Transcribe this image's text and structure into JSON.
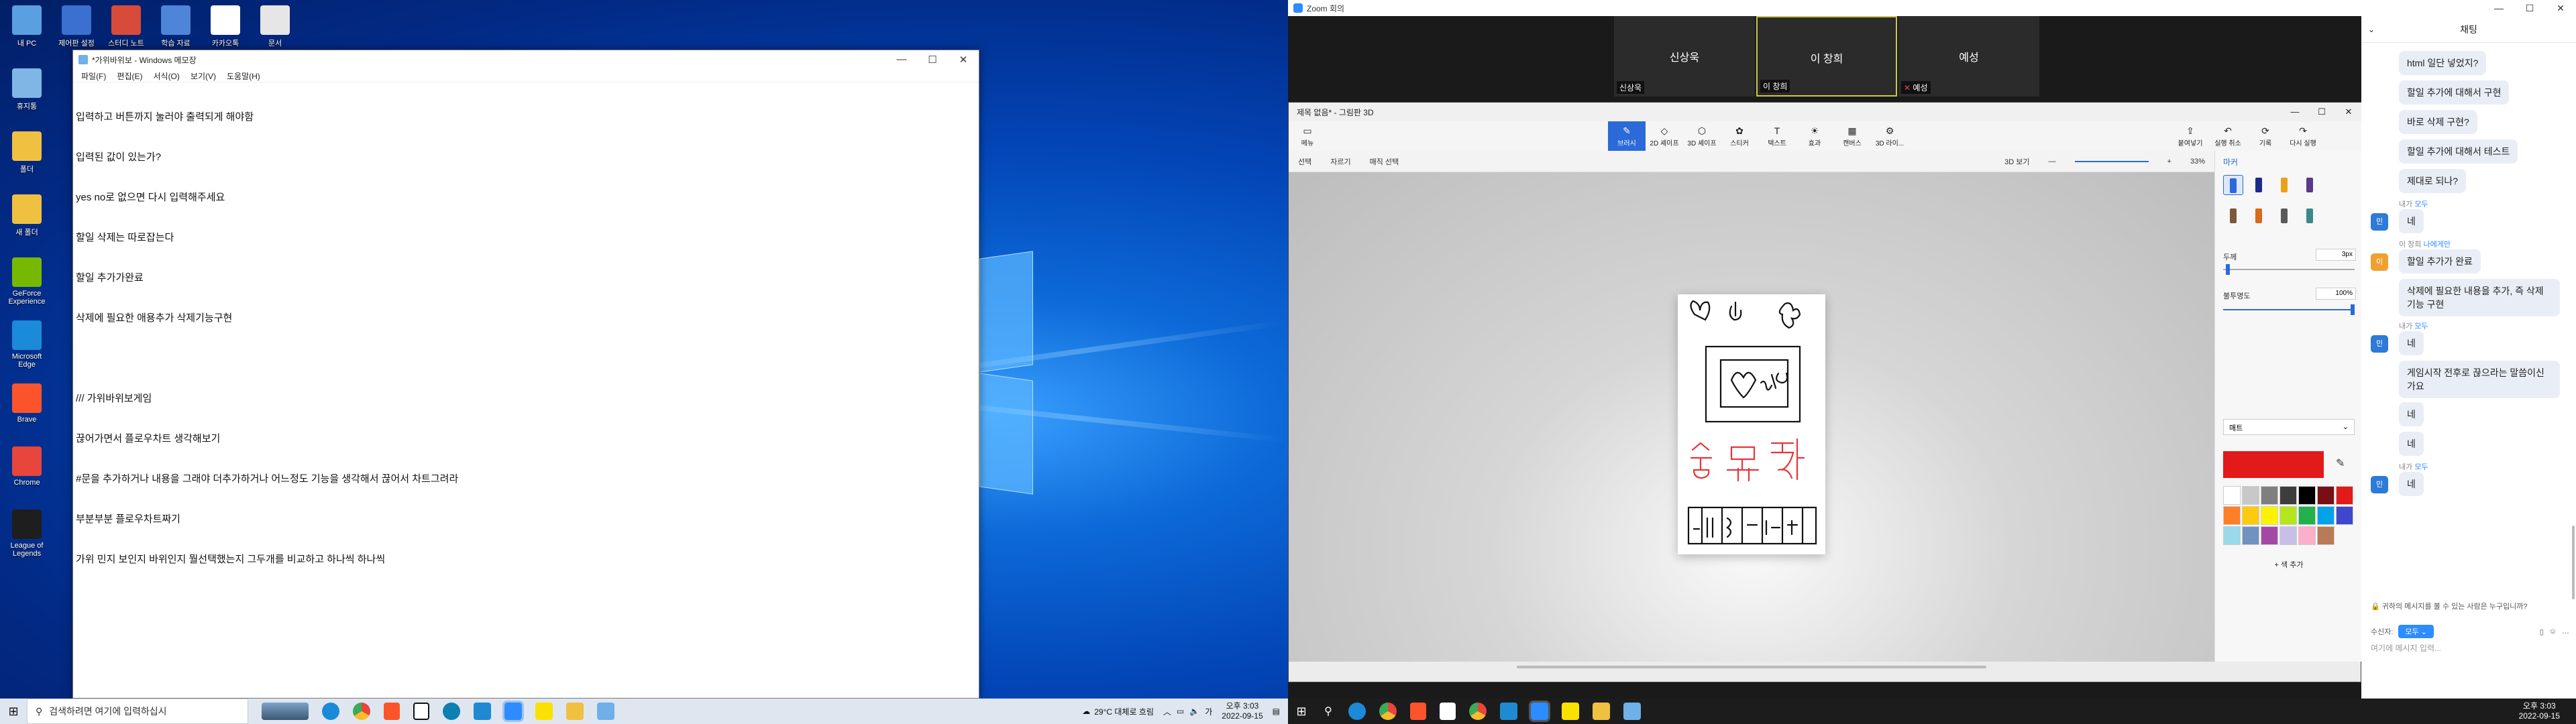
{
  "left_desktop": {
    "icons_col1": [
      {
        "label": "내 PC",
        "color": "#5aa0e0"
      },
      {
        "label": "휴지통",
        "color": "#7eb7e6"
      },
      {
        "label": "폴더",
        "color": "#f0c040"
      },
      {
        "label": "새 폴더",
        "color": "#f0c040"
      },
      {
        "label": "GeForce Experience",
        "color": "#76b900"
      },
      {
        "label": "Microsoft Edge",
        "color": "#1b8ad8"
      },
      {
        "label": "Brave",
        "color": "#fb542b"
      },
      {
        "label": "Chrome",
        "color": "#e8453c"
      },
      {
        "label": "League of Legends",
        "color": "#1e1e1e"
      }
    ],
    "icons_row_top": [
      {
        "label": "제어판 설정",
        "color": "#3b6fd0"
      },
      {
        "label": "스터디 노트",
        "color": "#d84a3a"
      },
      {
        "label": "학습 자료",
        "color": "#4f85d8"
      },
      {
        "label": "카카오톡",
        "color": "#ffffff"
      },
      {
        "label": "문서",
        "color": "#e6e6e6"
      }
    ]
  },
  "notepad": {
    "title": "*가위바위보 - Windows 메모장",
    "menu": [
      "파일(F)",
      "편집(E)",
      "서식(O)",
      "보기(V)",
      "도움말(H)"
    ],
    "lines": [
      "입력하고 버튼까지 눌러야 출력되게 해야함",
      "입력된 값이 있는가?",
      "yes no로 없으면 다시 입력해주세요",
      "할일 삭제는 따로잡는다",
      "할일 추가가완료",
      "삭제에 필요한 애용추가 삭제기능구현",
      "",
      "/// 가위바위보게임",
      "끊어가면서 플로우차트 생각해보기",
      "#문을 추가하거나 내용을 그래야 더추가하거나 어느정도 기능을 생각해서 끊어서 차트그려라",
      "부분부분 플로우차트짜기",
      "가위 민지 보인지 바위인지 뭘선택했는지 그두개를 비교하고 하나씩 하나씩"
    ]
  },
  "taskbar_left": {
    "search_placeholder": "검색하려면 여기에 입력하십시",
    "weather": "29°C 대체로 흐림",
    "ime": "가",
    "time": "오후 3:03",
    "date": "2022-09-15"
  },
  "zoom": {
    "title": "Zoom 회의",
    "participants": [
      {
        "name": "신상욱",
        "tag": "신상욱"
      },
      {
        "name": "이 창희",
        "tag": "이 창희",
        "active": true
      },
      {
        "name": "예성",
        "tag": "예성"
      }
    ],
    "chat": {
      "header": "채팅",
      "messages": [
        {
          "type": "bubble",
          "text": "html 일단 넣었지?"
        },
        {
          "type": "bubble",
          "text": "할일 추가에 대해서 구현"
        },
        {
          "type": "bubble",
          "text": "바로 삭제 구현?"
        },
        {
          "type": "bubble",
          "text": "할일 추가에 대해서 테스트"
        },
        {
          "type": "bubble",
          "text": "제대로 되나?"
        },
        {
          "type": "meta",
          "from": "내가",
          "to": "모두"
        },
        {
          "type": "reply",
          "avatar": "민",
          "text": "네"
        },
        {
          "type": "meta",
          "from": "이 창희",
          "to": "나에게만"
        },
        {
          "type": "reply",
          "avatar": "이",
          "text": "할일 추가가 완료"
        },
        {
          "type": "bubble",
          "text": "삭제에 필요한 내용을 추가, 즉 삭제 기능 구현"
        },
        {
          "type": "meta",
          "from": "내가",
          "to": "모두"
        },
        {
          "type": "reply",
          "avatar": "민",
          "text": "네"
        },
        {
          "type": "bubble",
          "text": "게임시작 전후로 끊으라는 말씀이신가요"
        },
        {
          "type": "bubble",
          "text": "네"
        },
        {
          "type": "bubble",
          "text": "네"
        },
        {
          "type": "meta",
          "from": "내가",
          "to": "모두"
        },
        {
          "type": "reply",
          "avatar": "민",
          "text": "네"
        }
      ],
      "notice": "귀하의 메시지를 볼 수 있는 사람은 누구입니까?",
      "to_label": "수신자:",
      "to_value": "모두",
      "input_placeholder": "여기에 메시지 입력..."
    }
  },
  "paint3d": {
    "title": "제목 없음* - 그림판 3D",
    "menu_label": "메뉴",
    "tools": [
      {
        "icon": "✎",
        "label": "브러시",
        "active": true
      },
      {
        "icon": "◇",
        "label": "2D 셰이프"
      },
      {
        "icon": "⬡",
        "label": "3D 셰이프"
      },
      {
        "icon": "✿",
        "label": "스티커"
      },
      {
        "icon": "T",
        "label": "텍스트"
      },
      {
        "icon": "☀",
        "label": "효과"
      },
      {
        "icon": "▦",
        "label": "캔버스"
      },
      {
        "icon": "⚙",
        "label": "3D 라이..."
      }
    ],
    "right_tools": [
      {
        "icon": "⇪",
        "label": "붙여넣기"
      },
      {
        "icon": "↶",
        "label": "실행 취소"
      },
      {
        "icon": "⟳",
        "label": "기록"
      },
      {
        "icon": "↷",
        "label": "다시 실행"
      }
    ],
    "subbar": [
      "선택",
      "자르기",
      "매직 선택"
    ],
    "view_label": "3D 보기",
    "zoom": "33%",
    "side_title": "마커",
    "thickness_label": "두께",
    "thickness_value": "3px",
    "opacity_label": "불투명도",
    "opacity_value": "100%",
    "finish_label": "매트",
    "add_color": "색 추가",
    "palette": [
      "#ffffff",
      "#c8c8c8",
      "#7f7f7f",
      "#3d3d3d",
      "#000000",
      "#7a0e15",
      "#e21a1a",
      "#ff7f27",
      "#ffc90e",
      "#fff200",
      "#b5e61d",
      "#22b14c",
      "#00a2e8",
      "#3f48cc",
      "#99d9ea",
      "#7092be",
      "#a349a4",
      "#c8bfe7",
      "#ffaec9",
      "#b97a57"
    ],
    "current_color": "#e21a1a"
  },
  "taskbar_right": {
    "time": "오후 3:03",
    "date": "2022-09-15"
  }
}
